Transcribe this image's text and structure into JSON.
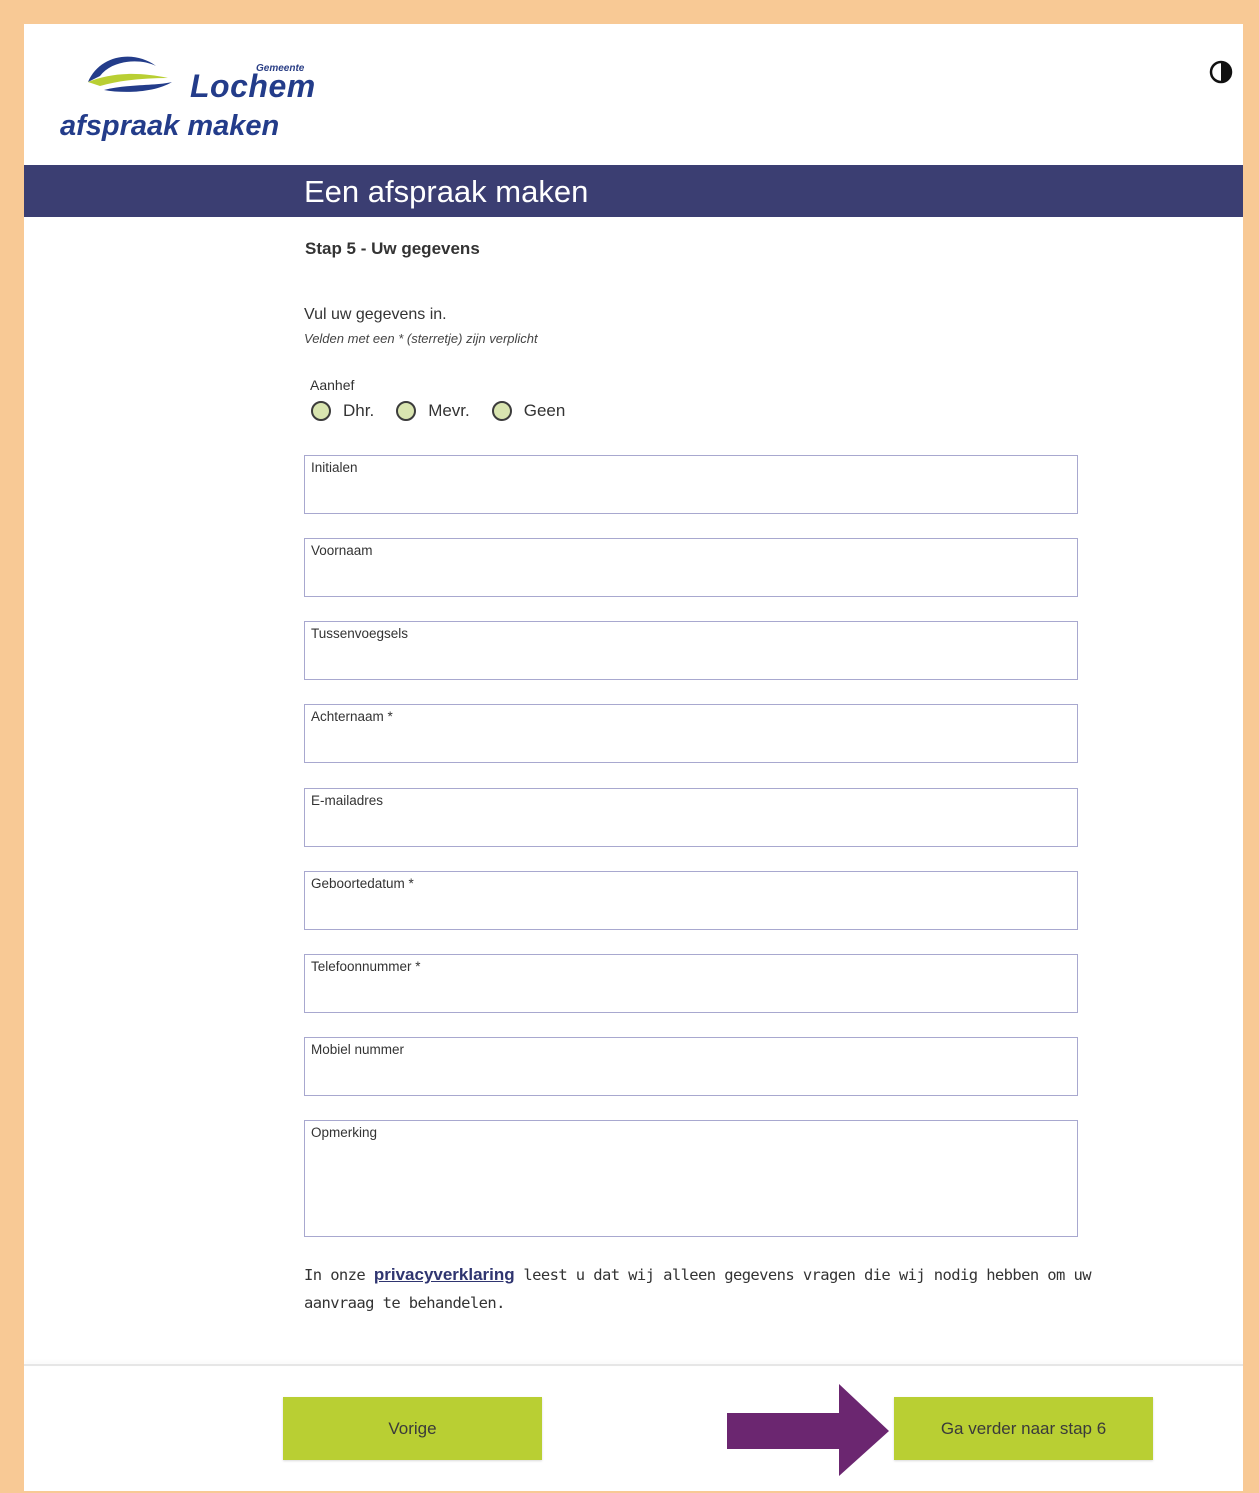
{
  "header": {
    "logo_small": "Gemeente",
    "logo_main": "Lochem",
    "logo_sub": "afspraak maken",
    "contrast_icon": "contrast-icon"
  },
  "banner": {
    "title": "Een afspraak maken"
  },
  "step": {
    "title": "Stap 5 - Uw gegevens"
  },
  "form": {
    "intro": "Vul uw gegevens in.",
    "required_note": "Velden met een * (sterretje) zijn verplicht",
    "salutation": {
      "label": "Aanhef",
      "options": [
        "Dhr.",
        "Mevr.",
        "Geen"
      ]
    },
    "fields": {
      "initials": "Initialen",
      "first_name": "Voornaam",
      "infix": "Tussenvoegsels",
      "last_name": "Achternaam *",
      "email": "E-mailadres",
      "birthdate": "Geboortedatum *",
      "phone": "Telefoonnummer *",
      "mobile": "Mobiel nummer",
      "remark": "Opmerking"
    }
  },
  "privacy": {
    "prefix": "In onze ",
    "link": "privacyverklaring",
    "suffix": " leest u dat wij alleen gegevens vragen die wij nodig hebben om uw aanvraag te behandelen."
  },
  "footer": {
    "prev_label": "Vorige",
    "next_label": "Ga verder naar stap 6"
  },
  "colors": {
    "banner": "#3b3e72",
    "button": "#b9cf33",
    "arrow": "#6b2670",
    "frame": "#f8c995",
    "radio_fill": "#d9e5b0"
  }
}
